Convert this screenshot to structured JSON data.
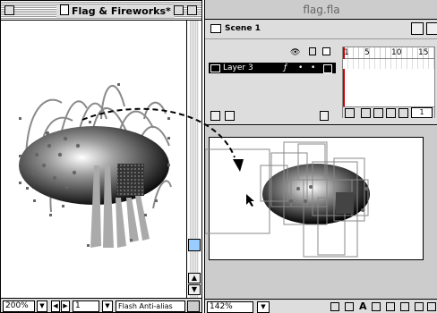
{
  "left_window": {
    "title": "Flag & Fireworks*",
    "zoom": "200%",
    "frame": "1",
    "quality": "Flash Anti-alias"
  },
  "right_window": {
    "title": "flag.fla",
    "scene": "Scene 1",
    "layer_name": "Layer 3",
    "frame_numbers": [
      "1",
      "5",
      "10",
      "15"
    ],
    "current_frame": "1",
    "zoom": "142%"
  },
  "colors": {
    "accent_scroll": "#99ccff",
    "curve": "#8a8a8a",
    "handle": "#666666"
  }
}
